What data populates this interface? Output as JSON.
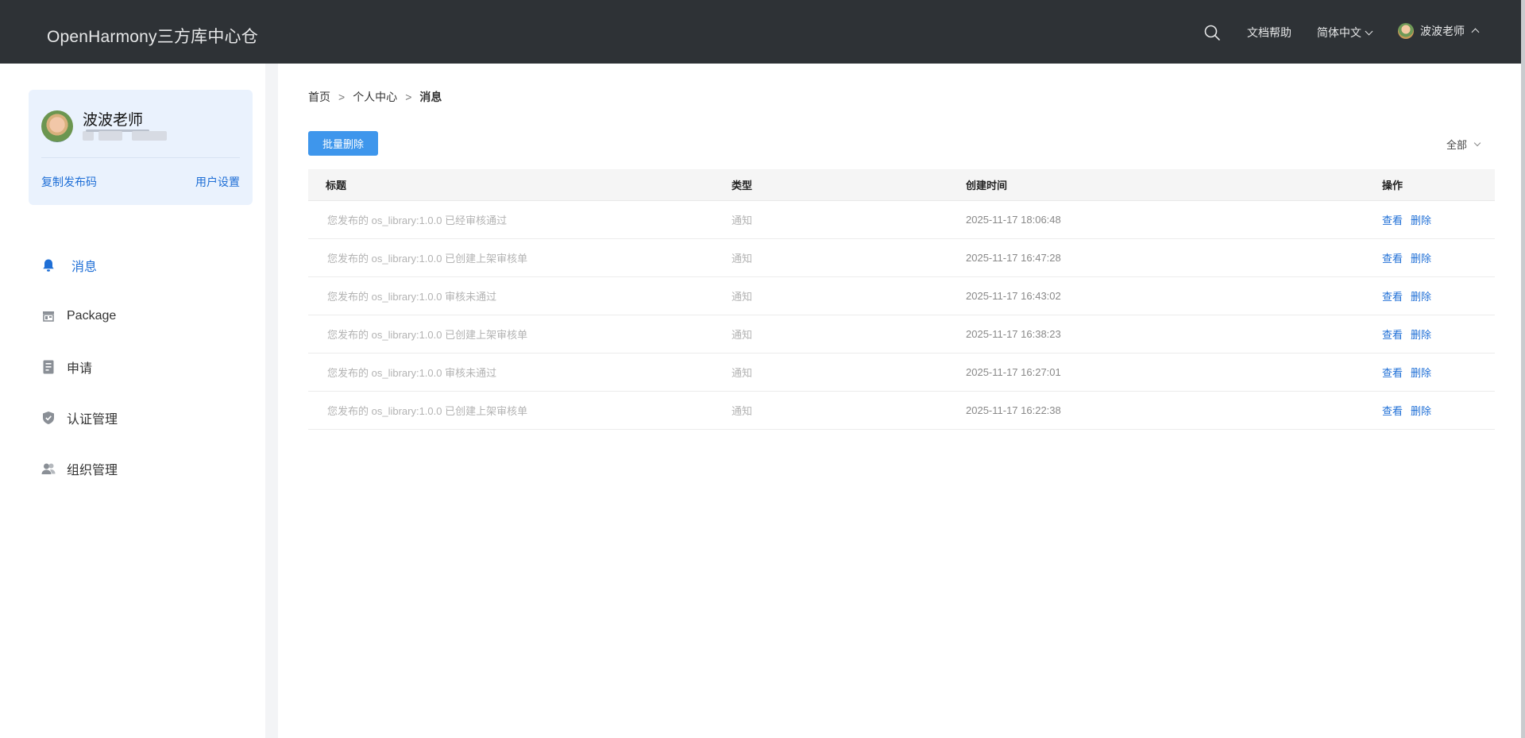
{
  "header": {
    "brand": "OpenHarmony三方库中心仓",
    "docs_label": "文档帮助",
    "language_label": "简体中文",
    "user_name": "波波老师",
    "search_icon": "search-icon"
  },
  "sidebar": {
    "profile": {
      "name": "波波老师",
      "copy_code_label": "复制发布码",
      "settings_label": "用户设置"
    },
    "nav": [
      {
        "label": "消息",
        "icon": "bell-icon",
        "active": true
      },
      {
        "label": "Package",
        "icon": "package-icon",
        "active": false
      },
      {
        "label": "申请",
        "icon": "document-icon",
        "active": false
      },
      {
        "label": "认证管理",
        "icon": "shield-icon",
        "active": false
      },
      {
        "label": "组织管理",
        "icon": "group-icon",
        "active": false
      }
    ]
  },
  "breadcrumb": [
    "首页",
    "个人中心",
    "消息"
  ],
  "toolbar": {
    "batch_delete_label": "批量删除",
    "filter_label": "全部"
  },
  "table": {
    "headers": {
      "title": "标题",
      "type": "类型",
      "time": "创建时间",
      "op": "操作"
    },
    "rows": [
      {
        "title": "您发布的 os_library:1.0.0 已经审核通过",
        "type": "通知",
        "time": "2025-11-17 18:06:48",
        "view": "查看",
        "delete": "删除"
      },
      {
        "title": "您发布的 os_library:1.0.0 已创建上架审核单",
        "type": "通知",
        "time": "2025-11-17 16:47:28",
        "view": "查看",
        "delete": "删除"
      },
      {
        "title": "您发布的 os_library:1.0.0 审核未通过",
        "type": "通知",
        "time": "2025-11-17 16:43:02",
        "view": "查看",
        "delete": "删除"
      },
      {
        "title": "您发布的 os_library:1.0.0 已创建上架审核单",
        "type": "通知",
        "time": "2025-11-17 16:38:23",
        "view": "查看",
        "delete": "删除"
      },
      {
        "title": "您发布的 os_library:1.0.0 审核未通过",
        "type": "通知",
        "time": "2025-11-17 16:27:01",
        "view": "查看",
        "delete": "删除"
      },
      {
        "title": "您发布的 os_library:1.0.0 已创建上架审核单",
        "type": "通知",
        "time": "2025-11-17 16:22:38",
        "view": "查看",
        "delete": "删除"
      }
    ]
  },
  "colors": {
    "header_bg": "#2e3236",
    "accent": "#1f6fd6",
    "button_bg": "#3e96ec",
    "profile_card_bg": "#eaf2fd"
  }
}
